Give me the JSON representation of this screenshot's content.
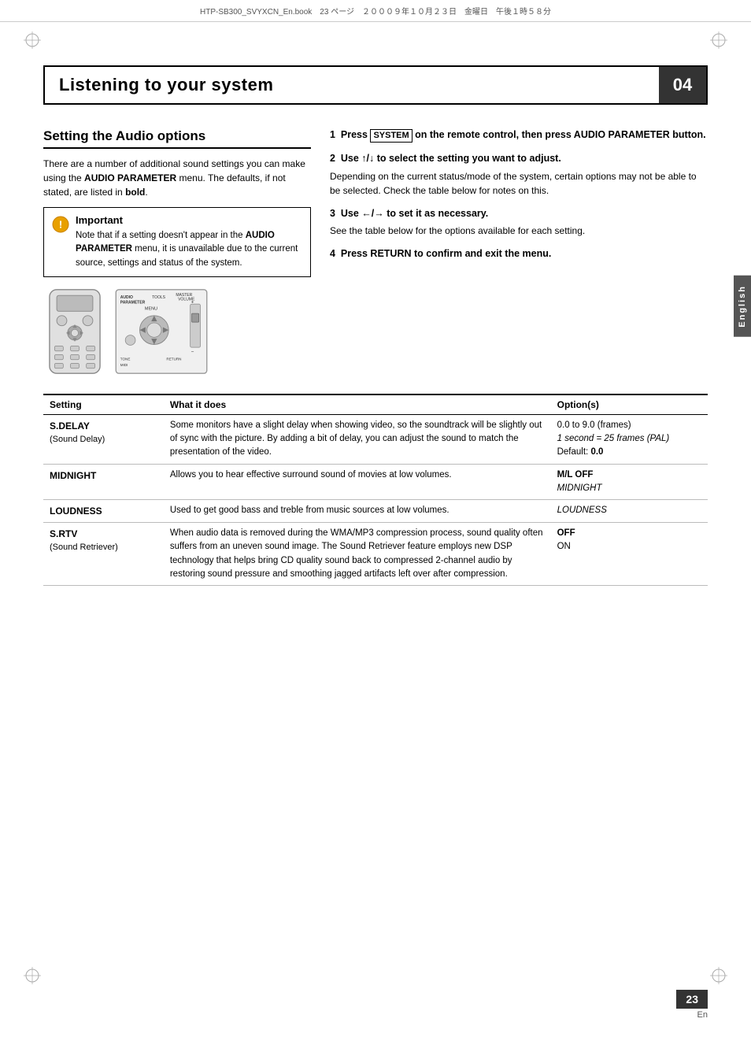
{
  "header": {
    "file_info": "HTP-SB300_SVYXCN_En.book　23 ページ　２０００９年１０月２３日　金曜日　午後１時５８分"
  },
  "chapter": {
    "title": "Listening to your system",
    "number": "04"
  },
  "section": {
    "heading": "Setting the Audio options",
    "intro": "There are a number of additional sound settings you can make using the AUDIO PARAMETER menu. The defaults, if not stated, are listed in bold."
  },
  "important": {
    "title": "Important",
    "text": "Note that if a setting doesn't appear in the AUDIO PARAMETER menu, it is unavailable due to the current source, settings and status of the system."
  },
  "steps": [
    {
      "number": "1",
      "title_pre": "Press ",
      "title_boxed": "SYSTEM",
      "title_post": " on the remote control, then press AUDIO PARAMETER button.",
      "body": ""
    },
    {
      "number": "2",
      "title": "Use ↑/↓ to select the setting you want to adjust.",
      "body": "Depending on the current status/mode of the system, certain options may not be able to be selected. Check the table below for notes on this."
    },
    {
      "number": "3",
      "title": "Use ←/→ to set it as necessary.",
      "body": "See the table below for the options available for each setting."
    },
    {
      "number": "4",
      "title": "Press RETURN to confirm and exit the menu.",
      "body": ""
    }
  ],
  "table": {
    "headers": [
      "Setting",
      "What it does",
      "Option(s)"
    ],
    "rows": [
      {
        "setting": "S.DELAY",
        "setting_sub": "(Sound Delay)",
        "what": "Some monitors have a slight delay when showing video, so the soundtrack will be slightly out of sync with the picture. By adding a bit of delay, you can adjust the sound to match the presentation of the video.",
        "options": [
          "0.0 to 9.0 (frames)",
          "1 second = 25 frames (PAL)",
          "Default: 0.0"
        ]
      },
      {
        "setting": "MIDNIGHT",
        "setting_sub": "",
        "what": "Allows you to hear effective surround sound of movies at low volumes.",
        "options": [
          "M/L OFF",
          "MIDNIGHT"
        ]
      },
      {
        "setting": "LOUDNESS",
        "setting_sub": "",
        "what": "Used to get good bass and treble from music sources at low volumes.",
        "options": [
          "LOUDNESS"
        ]
      },
      {
        "setting": "S.RTV",
        "setting_sub": "(Sound Retriever)",
        "what": "When audio data is removed during the WMA/MP3 compression process, sound quality often suffers from an uneven sound image. The Sound Retriever feature employs new DSP technology that helps bring CD quality sound back to compressed 2-channel audio by restoring sound pressure and smoothing jagged artifacts left over after compression.",
        "options": [
          "OFF",
          "ON"
        ]
      }
    ]
  },
  "sidebar": {
    "label": "English"
  },
  "footer": {
    "page_number": "23",
    "page_lang": "En"
  }
}
